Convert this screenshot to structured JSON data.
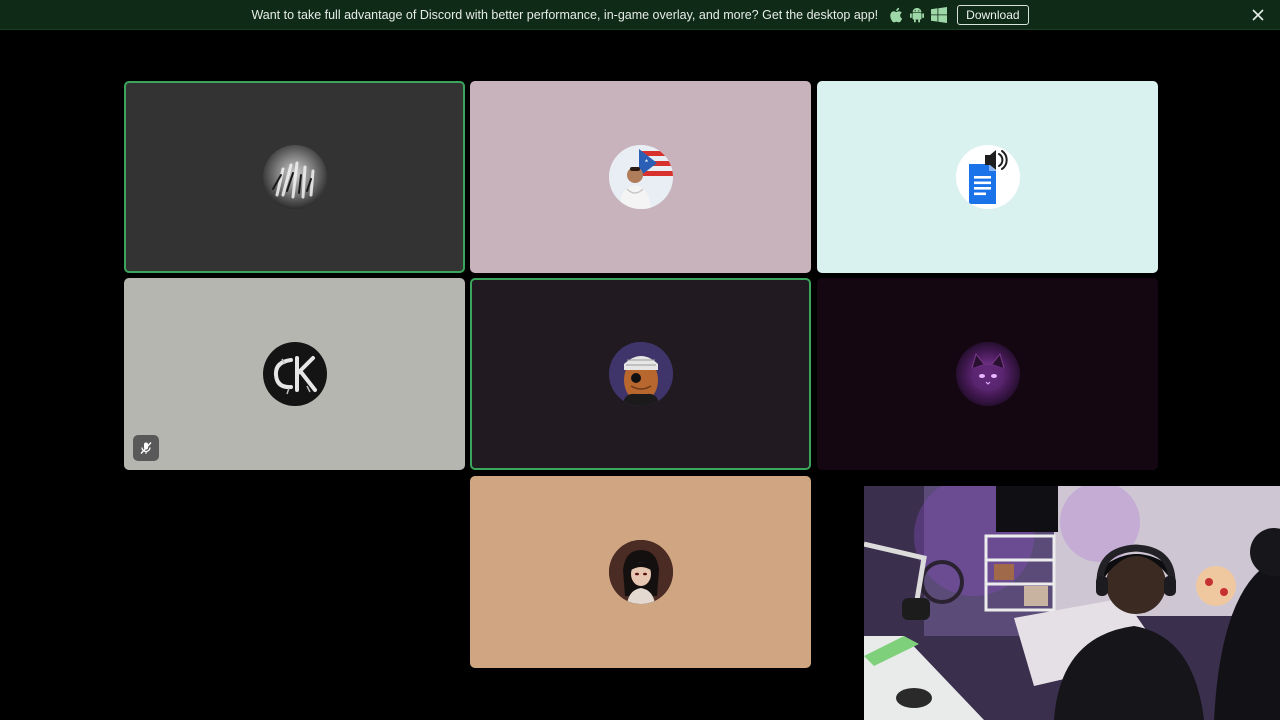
{
  "banner": {
    "message": "Want to take full advantage of Discord with better performance, in-game overlay, and more? Get the desktop app!",
    "download_label": "Download",
    "icons": [
      "apple-icon",
      "android-icon",
      "windows-icon",
      "close-icon"
    ]
  },
  "call": {
    "participants": [
      {
        "tile": "participant-tile-1",
        "avatar": "hands-avatar",
        "speaking": true,
        "muted": false,
        "tile_color": "#333333"
      },
      {
        "tile": "participant-tile-2",
        "avatar": "flag-avatar",
        "speaking": false,
        "muted": false,
        "tile_color": "#c8b3bd"
      },
      {
        "tile": "participant-tile-3",
        "avatar": "document-speaker-avatar",
        "speaking": false,
        "muted": false,
        "tile_color": "#d9f2f0"
      },
      {
        "tile": "participant-tile-4",
        "avatar": "ck-logo-avatar",
        "speaking": false,
        "muted": true,
        "tile_color": "#b6b6b1"
      },
      {
        "tile": "participant-tile-5",
        "avatar": "masked-ninja-avatar",
        "speaking": true,
        "muted": false,
        "tile_color": "#211b21"
      },
      {
        "tile": "participant-tile-6",
        "avatar": "purple-cat-avatar",
        "speaking": false,
        "muted": false,
        "tile_color": "#150712"
      },
      {
        "tile": "participant-tile-7",
        "avatar": "anime-character-avatar",
        "speaking": false,
        "muted": false,
        "tile_color": "#cfa582"
      }
    ],
    "speaking_color": "#3ba55c"
  },
  "webcam": {
    "label": "streamer-webcam-overlay"
  }
}
